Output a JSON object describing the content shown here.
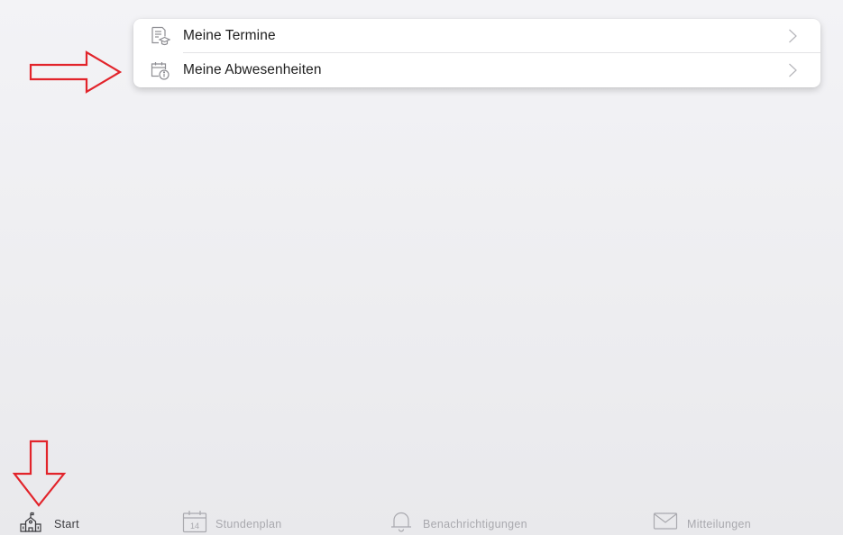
{
  "menu": {
    "items": [
      {
        "label": "Meine Termine",
        "icon": "appointments-icon"
      },
      {
        "label": "Meine Abwesenheiten",
        "icon": "absences-calendar-icon"
      }
    ]
  },
  "calendar_icon_day": "14",
  "tabbar": {
    "active": "Start",
    "tabs": [
      {
        "label": "Start",
        "icon": "school-building-icon"
      },
      {
        "label": "Stundenplan",
        "icon": "calendar-icon"
      },
      {
        "label": "Benachrichtigungen",
        "icon": "bell-icon"
      },
      {
        "label": "Mitteilungen",
        "icon": "envelope-icon"
      }
    ]
  },
  "colors": {
    "annotation_arrow": "#e2242b",
    "inactive_tab": "#a9a9ae",
    "active_tab": "#3a3a3e",
    "icon_gray": "#8e8e93"
  }
}
